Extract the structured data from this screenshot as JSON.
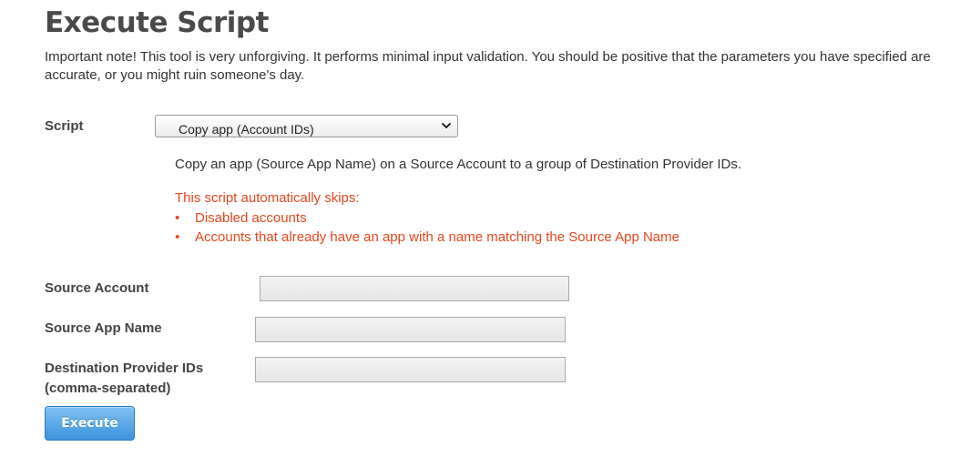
{
  "page": {
    "title": "Execute Script",
    "note": "Important note! This tool is very unforgiving. It performs minimal input validation. You should be positive that the parameters you have specified are accurate, or you might ruin someone's day."
  },
  "script": {
    "label": "Script",
    "selected": "Copy app (Account IDs)",
    "description": "Copy an app (Source App Name) on a Source Account to a group of Destination Provider IDs.",
    "skips_title": "This script automatically skips:",
    "skips": [
      "Disabled accounts",
      "Accounts that already have an app with a name matching the Source App Name"
    ],
    "bullet": "•"
  },
  "fields": {
    "source_account": {
      "label": "Source Account",
      "value": ""
    },
    "source_app_name": {
      "label": "Source App Name",
      "value": ""
    },
    "destination_provider_ids": {
      "label_line1": "Destination Provider IDs",
      "label_line2": "(comma-separated)",
      "value": ""
    }
  },
  "actions": {
    "execute_label": "Execute"
  },
  "colors": {
    "warning": "#e8461e",
    "button": "#3d93db"
  },
  "icons": {
    "select_arrow": "chevron-down-icon"
  }
}
